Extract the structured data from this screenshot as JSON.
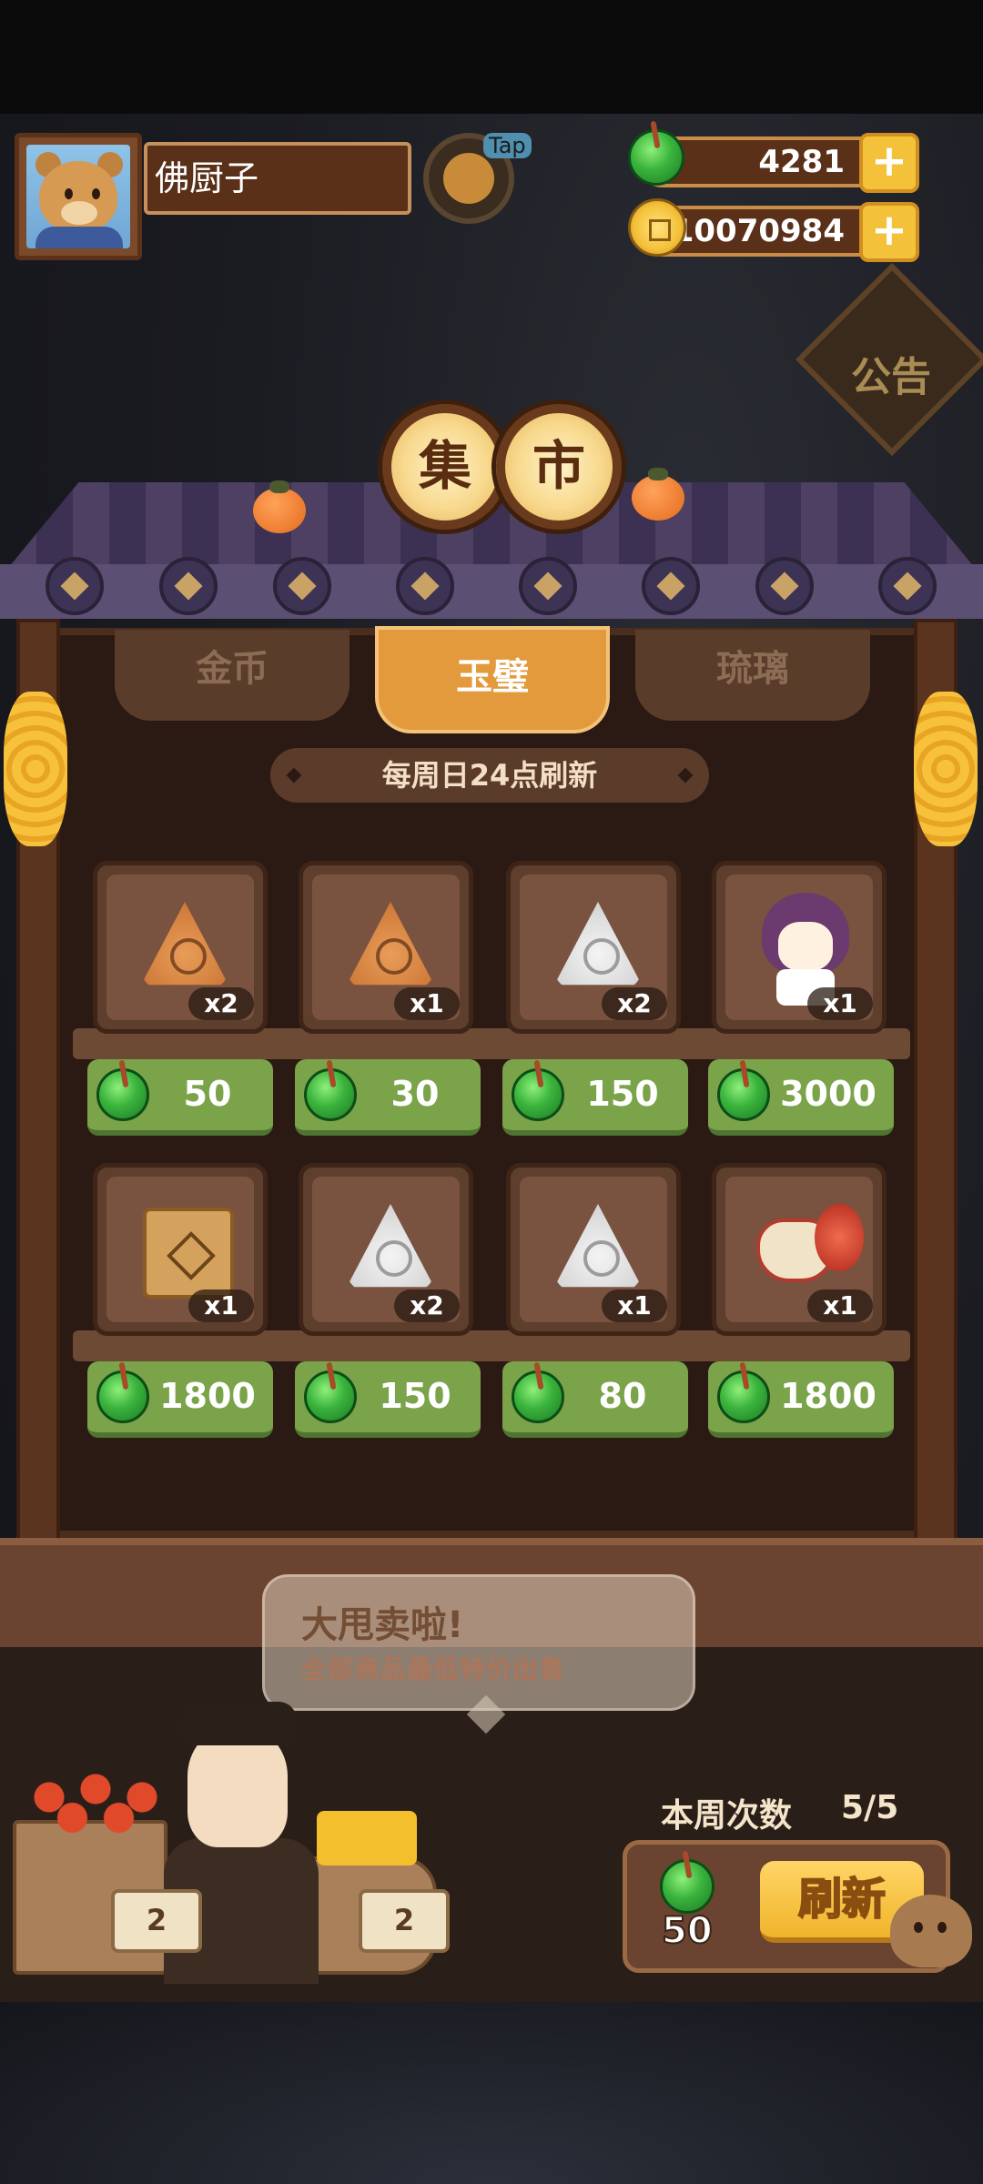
{
  "player": {
    "name": "佛厨子"
  },
  "tap_button": {
    "label": "Tap"
  },
  "currencies": {
    "jade": {
      "value": "4281",
      "plus": "+"
    },
    "coins": {
      "value": "10070984",
      "plus": "+"
    }
  },
  "notice_sign": {
    "label": "公告"
  },
  "market_title": {
    "char1": "集",
    "char2": "市"
  },
  "tabs": [
    {
      "label": "金币",
      "active": false
    },
    {
      "label": "玉璧",
      "active": true
    },
    {
      "label": "琉璃",
      "active": false
    }
  ],
  "refresh_note": "每周日24点刷新",
  "items": [
    {
      "name": "brown-triangle-token-flower",
      "qty": "x2",
      "price": "50"
    },
    {
      "name": "brown-triangle-token-tassel",
      "qty": "x1",
      "price": "30"
    },
    {
      "name": "white-triangle-token-wave",
      "qty": "x2",
      "price": "150"
    },
    {
      "name": "chibi-girl-character",
      "qty": "x1",
      "price": "3000"
    },
    {
      "name": "treasure-chest",
      "qty": "x1",
      "price": "1800"
    },
    {
      "name": "white-triangle-token-leaf",
      "qty": "x2",
      "price": "150"
    },
    {
      "name": "white-triangle-token-beetle",
      "qty": "x1",
      "price": "80"
    },
    {
      "name": "porcelain-jar",
      "qty": "x1",
      "price": "1800"
    }
  ],
  "merchant_bubble": {
    "title": "大甩卖啦!",
    "subtitle": "全部商品最低特价出售"
  },
  "stall_tags": [
    "2",
    "2"
  ],
  "weekly": {
    "label": "本周次数",
    "value": "5/5"
  },
  "refresh": {
    "cost": "50",
    "button": "刷新"
  },
  "colors": {
    "price_bg": "#7aa34a",
    "active_tab": "#e29a3c",
    "jade": "#3ab33c"
  },
  "icons": {
    "jade": "jade-bi-icon",
    "coin": "gold-coin-icon",
    "plus": "plus-icon"
  }
}
